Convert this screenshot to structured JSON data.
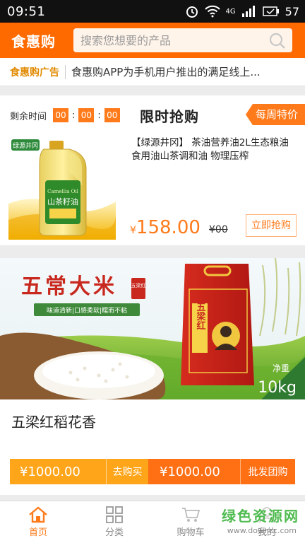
{
  "status_bar": {
    "time": "09:51",
    "network": "4G",
    "battery": "57"
  },
  "header": {
    "brand": "食惠购",
    "search_placeholder": "搜索您想要的产品"
  },
  "notice": {
    "tag": "食惠购广告",
    "message": "食惠购APP为手机用户推出的满足线上..."
  },
  "flash_sale": {
    "countdown_label": "剩余时间",
    "hours": "00",
    "minutes": "00",
    "seconds": "00",
    "title": "限时抢购",
    "weekly_badge": "每周特价",
    "product_name": "【绿源井冈】 茶油营养油2L生态粮油食用油山茶调和油 物理压榨",
    "currency": "¥",
    "price": "158.00",
    "old_price": "¥00",
    "buy_button": "立即抢购",
    "image_text": {
      "brand": "绿源井冈",
      "label": "山茶籽油",
      "sub": "Camellia Oil"
    }
  },
  "rice_product": {
    "banner": {
      "headline": "五常大米",
      "seal": "五梁红",
      "slogan": "味道清新|口感柔软|糯而不粘",
      "bag_label": "五梁红",
      "weight_label": "净重",
      "weight_value": "10kg"
    },
    "name": "五梁红稻花香",
    "retail_price": "¥1000.00",
    "retail_button": "去购买",
    "wholesale_price": "¥1000.00",
    "wholesale_button": "批发团购"
  },
  "tabbar": {
    "items": [
      {
        "label": "首页",
        "icon": "home-icon",
        "active": true
      },
      {
        "label": "分类",
        "icon": "grid-icon",
        "active": false
      },
      {
        "label": "购物车",
        "icon": "cart-icon",
        "active": false
      },
      {
        "label": "我的",
        "icon": "user-icon",
        "active": false
      }
    ]
  },
  "watermark": {
    "line1": "绿色资源网",
    "line2": "www.downcc.com"
  },
  "colors": {
    "accent": "#ff6a00",
    "price": "#ff7a1a",
    "buy_bar_light": "#ffa51a"
  }
}
